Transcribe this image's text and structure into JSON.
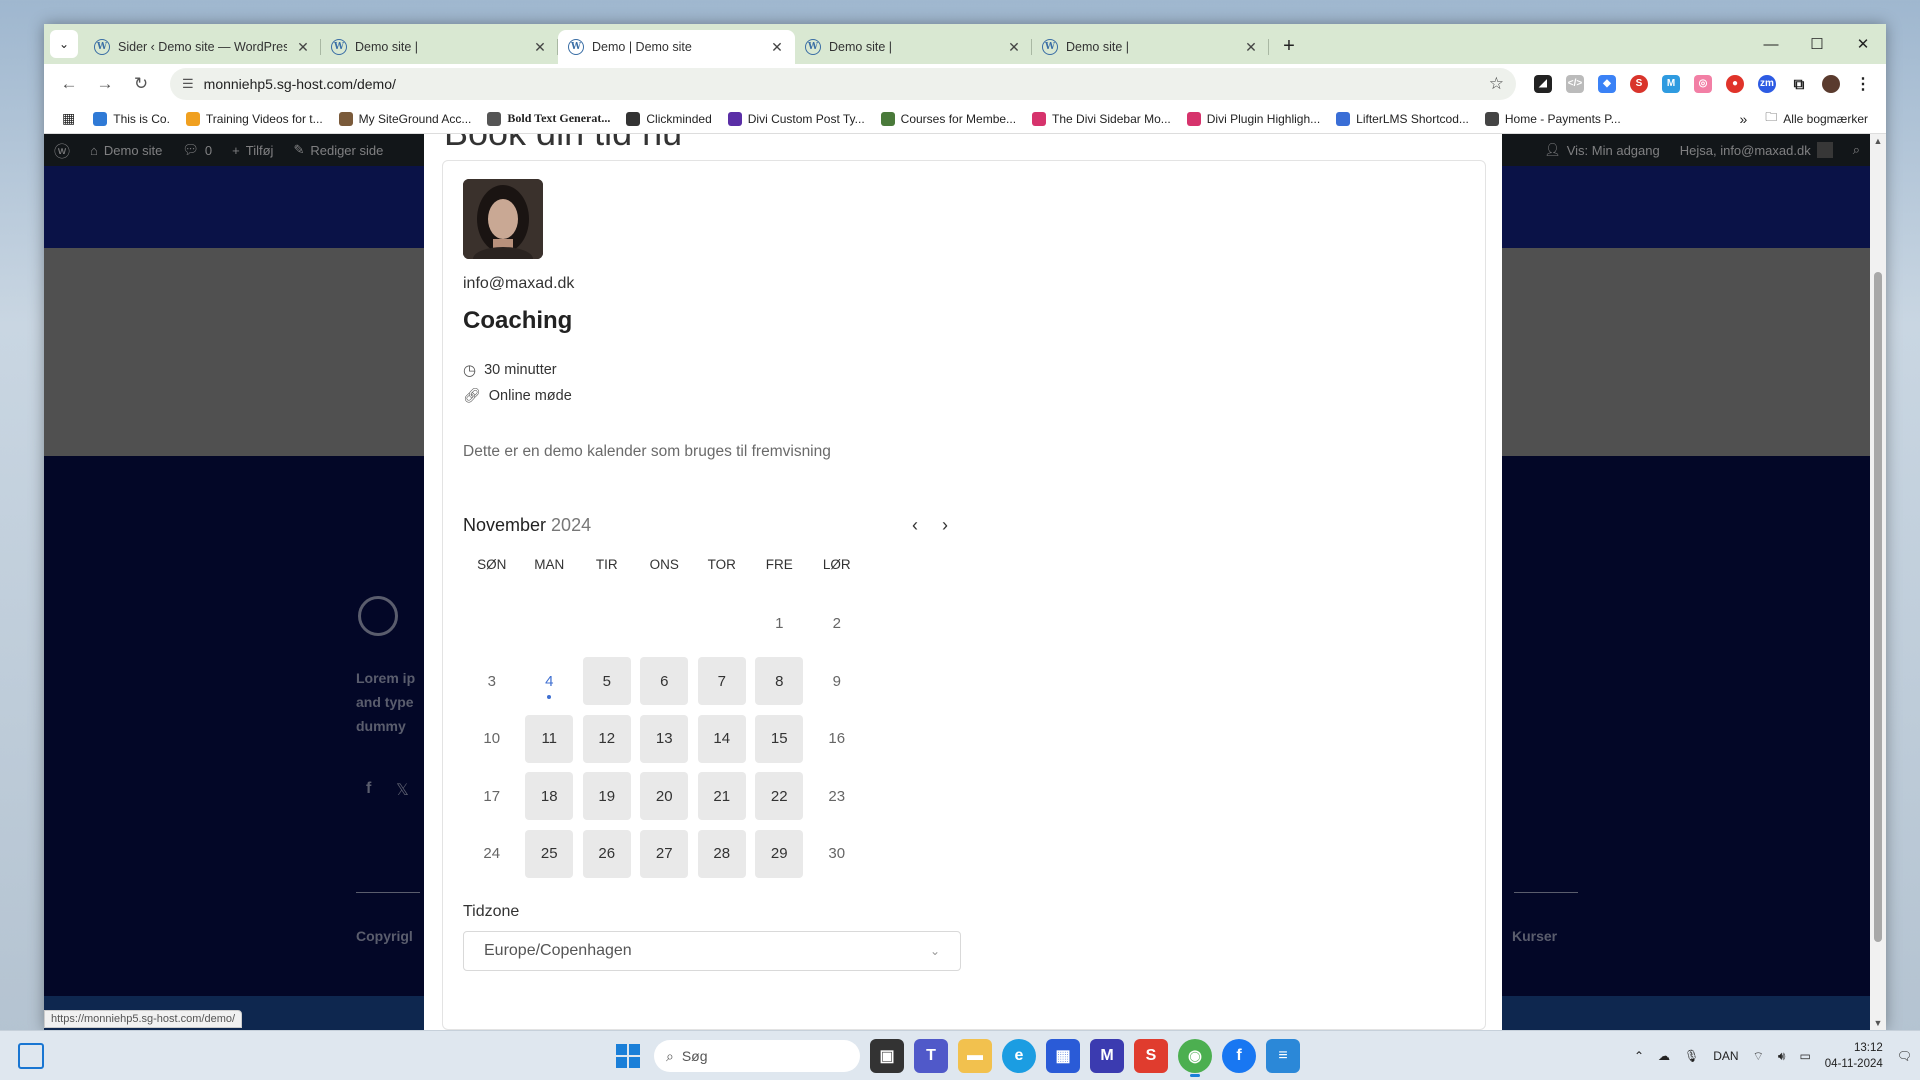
{
  "browser": {
    "tabs": [
      {
        "title": "Sider ‹ Demo site — WordPress",
        "active": false
      },
      {
        "title": "Demo site |",
        "active": false
      },
      {
        "title": "Demo | Demo site",
        "active": true
      },
      {
        "title": "Demo site |",
        "active": false
      },
      {
        "title": "Demo site |",
        "active": false
      }
    ],
    "new_tab": "+",
    "tab_list": "⌄",
    "window_controls": {
      "minimize": "—",
      "maximize": "☐",
      "close": "✕"
    },
    "url": "monniehp5.sg-host.com/demo/",
    "bookmarks": [
      {
        "label": "This is Co.",
        "color": "#2f7ad6",
        "bold": false
      },
      {
        "label": "Training Videos for t...",
        "color": "#f0a020",
        "bold": false
      },
      {
        "label": "My SiteGround Acc...",
        "color": "#7a5a3a",
        "bold": false
      },
      {
        "label": "Bold Text Generat...",
        "color": "#555555",
        "bold": true
      },
      {
        "label": "Clickminded",
        "color": "#333333",
        "bold": false
      },
      {
        "label": "Divi Custom Post Ty...",
        "color": "#5a2ea6",
        "bold": false
      },
      {
        "label": "Courses for Membe...",
        "color": "#4a7a3a",
        "bold": false
      },
      {
        "label": "The Divi Sidebar Mo...",
        "color": "#d6336c",
        "bold": false
      },
      {
        "label": "Divi Plugin Highligh...",
        "color": "#d6336c",
        "bold": false
      },
      {
        "label": "LifterLMS Shortcod...",
        "color": "#3a6ed6",
        "bold": false
      },
      {
        "label": "Home - Payments P...",
        "color": "#444444",
        "bold": false
      }
    ],
    "bookmarks_overflow": "»",
    "all_bookmarks": "Alle bogmærker",
    "status_url": "https://monniehp5.sg-host.com/demo/"
  },
  "adminbar": {
    "site": "Demo site",
    "comments": "0",
    "add": "Tilføj",
    "edit": "Rediger side",
    "my_access": "Vis: Min adgang",
    "greeting": "Hejsa, info@maxad.dk"
  },
  "background_page": {
    "footer_text": [
      "Lorem ip",
      "and type",
      "dummy"
    ],
    "copyright": "Copyrigl",
    "kurser": "Kurser"
  },
  "booking": {
    "heading": "Book din tid nu",
    "email": "info@maxad.dk",
    "event_title": "Coaching",
    "duration": "30 minutter",
    "location": "Online møde",
    "description": "Dette er en demo kalender som bruges til fremvisning",
    "calendar": {
      "month": "November",
      "year": "2024",
      "weekdays": [
        "SØN",
        "MAN",
        "TIR",
        "ONS",
        "TOR",
        "FRE",
        "LØR"
      ],
      "leading_blanks": 5,
      "days_in_month": 30,
      "today": 4,
      "available_days": [
        5,
        6,
        7,
        8,
        11,
        12,
        13,
        14,
        15,
        18,
        19,
        20,
        21,
        22,
        25,
        26,
        27,
        28,
        29
      ]
    },
    "timezone_label": "Tidzone",
    "timezone_value": "Europe/Copenhagen"
  },
  "taskbar": {
    "search_placeholder": "Søg",
    "language": "DAN",
    "time": "13:12",
    "date": "04-11-2024"
  }
}
